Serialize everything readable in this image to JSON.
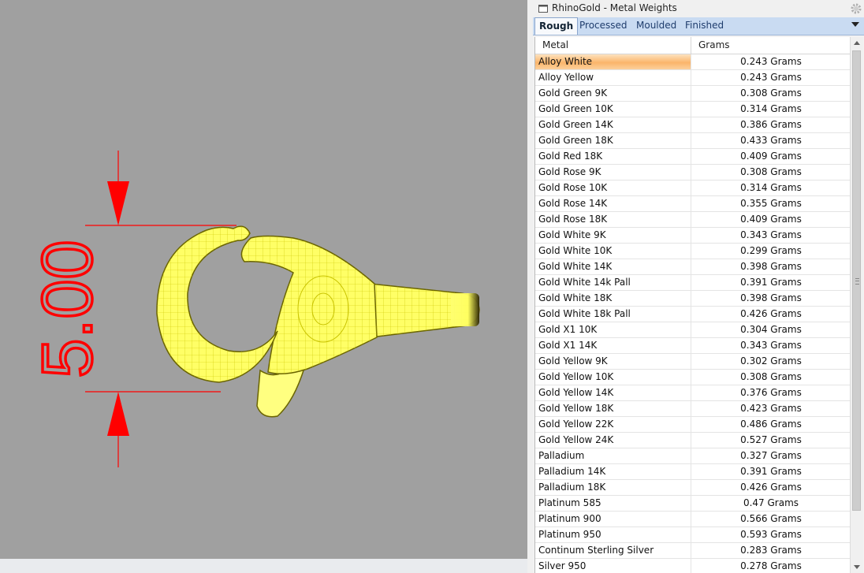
{
  "viewport": {
    "dimension_text": "5.00",
    "dimension_color": "#ff0000",
    "object_color": "#ffff55",
    "background_color": "#a0a0a0"
  },
  "panel": {
    "title": "RhinoGold - Metal Weights",
    "icons": {
      "app": "rhinogold-app-icon",
      "settings": "gear-icon",
      "tab_menu": "chevron-down-icon"
    },
    "tabs": [
      {
        "label": "Rough",
        "active": true
      },
      {
        "label": "Processed",
        "active": false
      },
      {
        "label": "Moulded",
        "active": false
      },
      {
        "label": "Finished",
        "active": false
      }
    ],
    "columns": {
      "metal": "Metal",
      "grams": "Grams"
    },
    "selection_color": "#fbb56a",
    "rows": [
      {
        "metal": "Alloy White",
        "grams": "0.243 Grams"
      },
      {
        "metal": "Alloy Yellow",
        "grams": "0.243 Grams"
      },
      {
        "metal": "Gold Green 9K",
        "grams": "0.308 Grams"
      },
      {
        "metal": "Gold Green 10K",
        "grams": "0.314 Grams"
      },
      {
        "metal": "Gold Green 14K",
        "grams": "0.386 Grams"
      },
      {
        "metal": "Gold Green 18K",
        "grams": "0.433 Grams"
      },
      {
        "metal": "Gold Red 18K",
        "grams": "0.409 Grams"
      },
      {
        "metal": "Gold Rose 9K",
        "grams": "0.308 Grams"
      },
      {
        "metal": "Gold Rose 10K",
        "grams": "0.314 Grams"
      },
      {
        "metal": "Gold Rose 14K",
        "grams": "0.355 Grams"
      },
      {
        "metal": "Gold Rose 18K",
        "grams": "0.409 Grams"
      },
      {
        "metal": "Gold White 9K",
        "grams": "0.343 Grams"
      },
      {
        "metal": "Gold White 10K",
        "grams": "0.299 Grams"
      },
      {
        "metal": "Gold White 14K",
        "grams": "0.398 Grams"
      },
      {
        "metal": "Gold White 14k Pall",
        "grams": "0.391 Grams"
      },
      {
        "metal": "Gold White 18K",
        "grams": "0.398 Grams"
      },
      {
        "metal": "Gold White 18k Pall",
        "grams": "0.426 Grams"
      },
      {
        "metal": "Gold X1 10K",
        "grams": "0.304 Grams"
      },
      {
        "metal": "Gold X1 14K",
        "grams": "0.343 Grams"
      },
      {
        "metal": "Gold Yellow 9K",
        "grams": "0.302 Grams"
      },
      {
        "metal": "Gold Yellow 10K",
        "grams": "0.308 Grams"
      },
      {
        "metal": "Gold Yellow 14K",
        "grams": "0.376 Grams"
      },
      {
        "metal": "Gold Yellow 18K",
        "grams": "0.423 Grams"
      },
      {
        "metal": "Gold Yellow 22K",
        "grams": "0.486 Grams"
      },
      {
        "metal": "Gold Yellow 24K",
        "grams": "0.527 Grams"
      },
      {
        "metal": "Palladium",
        "grams": "0.327 Grams"
      },
      {
        "metal": "Palladium 14K",
        "grams": "0.391 Grams"
      },
      {
        "metal": "Palladium 18K",
        "grams": "0.426 Grams"
      },
      {
        "metal": "Platinum 585",
        "grams": "0.47 Grams"
      },
      {
        "metal": "Platinum 900",
        "grams": "0.566 Grams"
      },
      {
        "metal": "Platinum 950",
        "grams": "0.593 Grams"
      },
      {
        "metal": "Continum Sterling Silver",
        "grams": "0.283 Grams"
      },
      {
        "metal": "Silver 950",
        "grams": "0.278 Grams"
      }
    ]
  }
}
